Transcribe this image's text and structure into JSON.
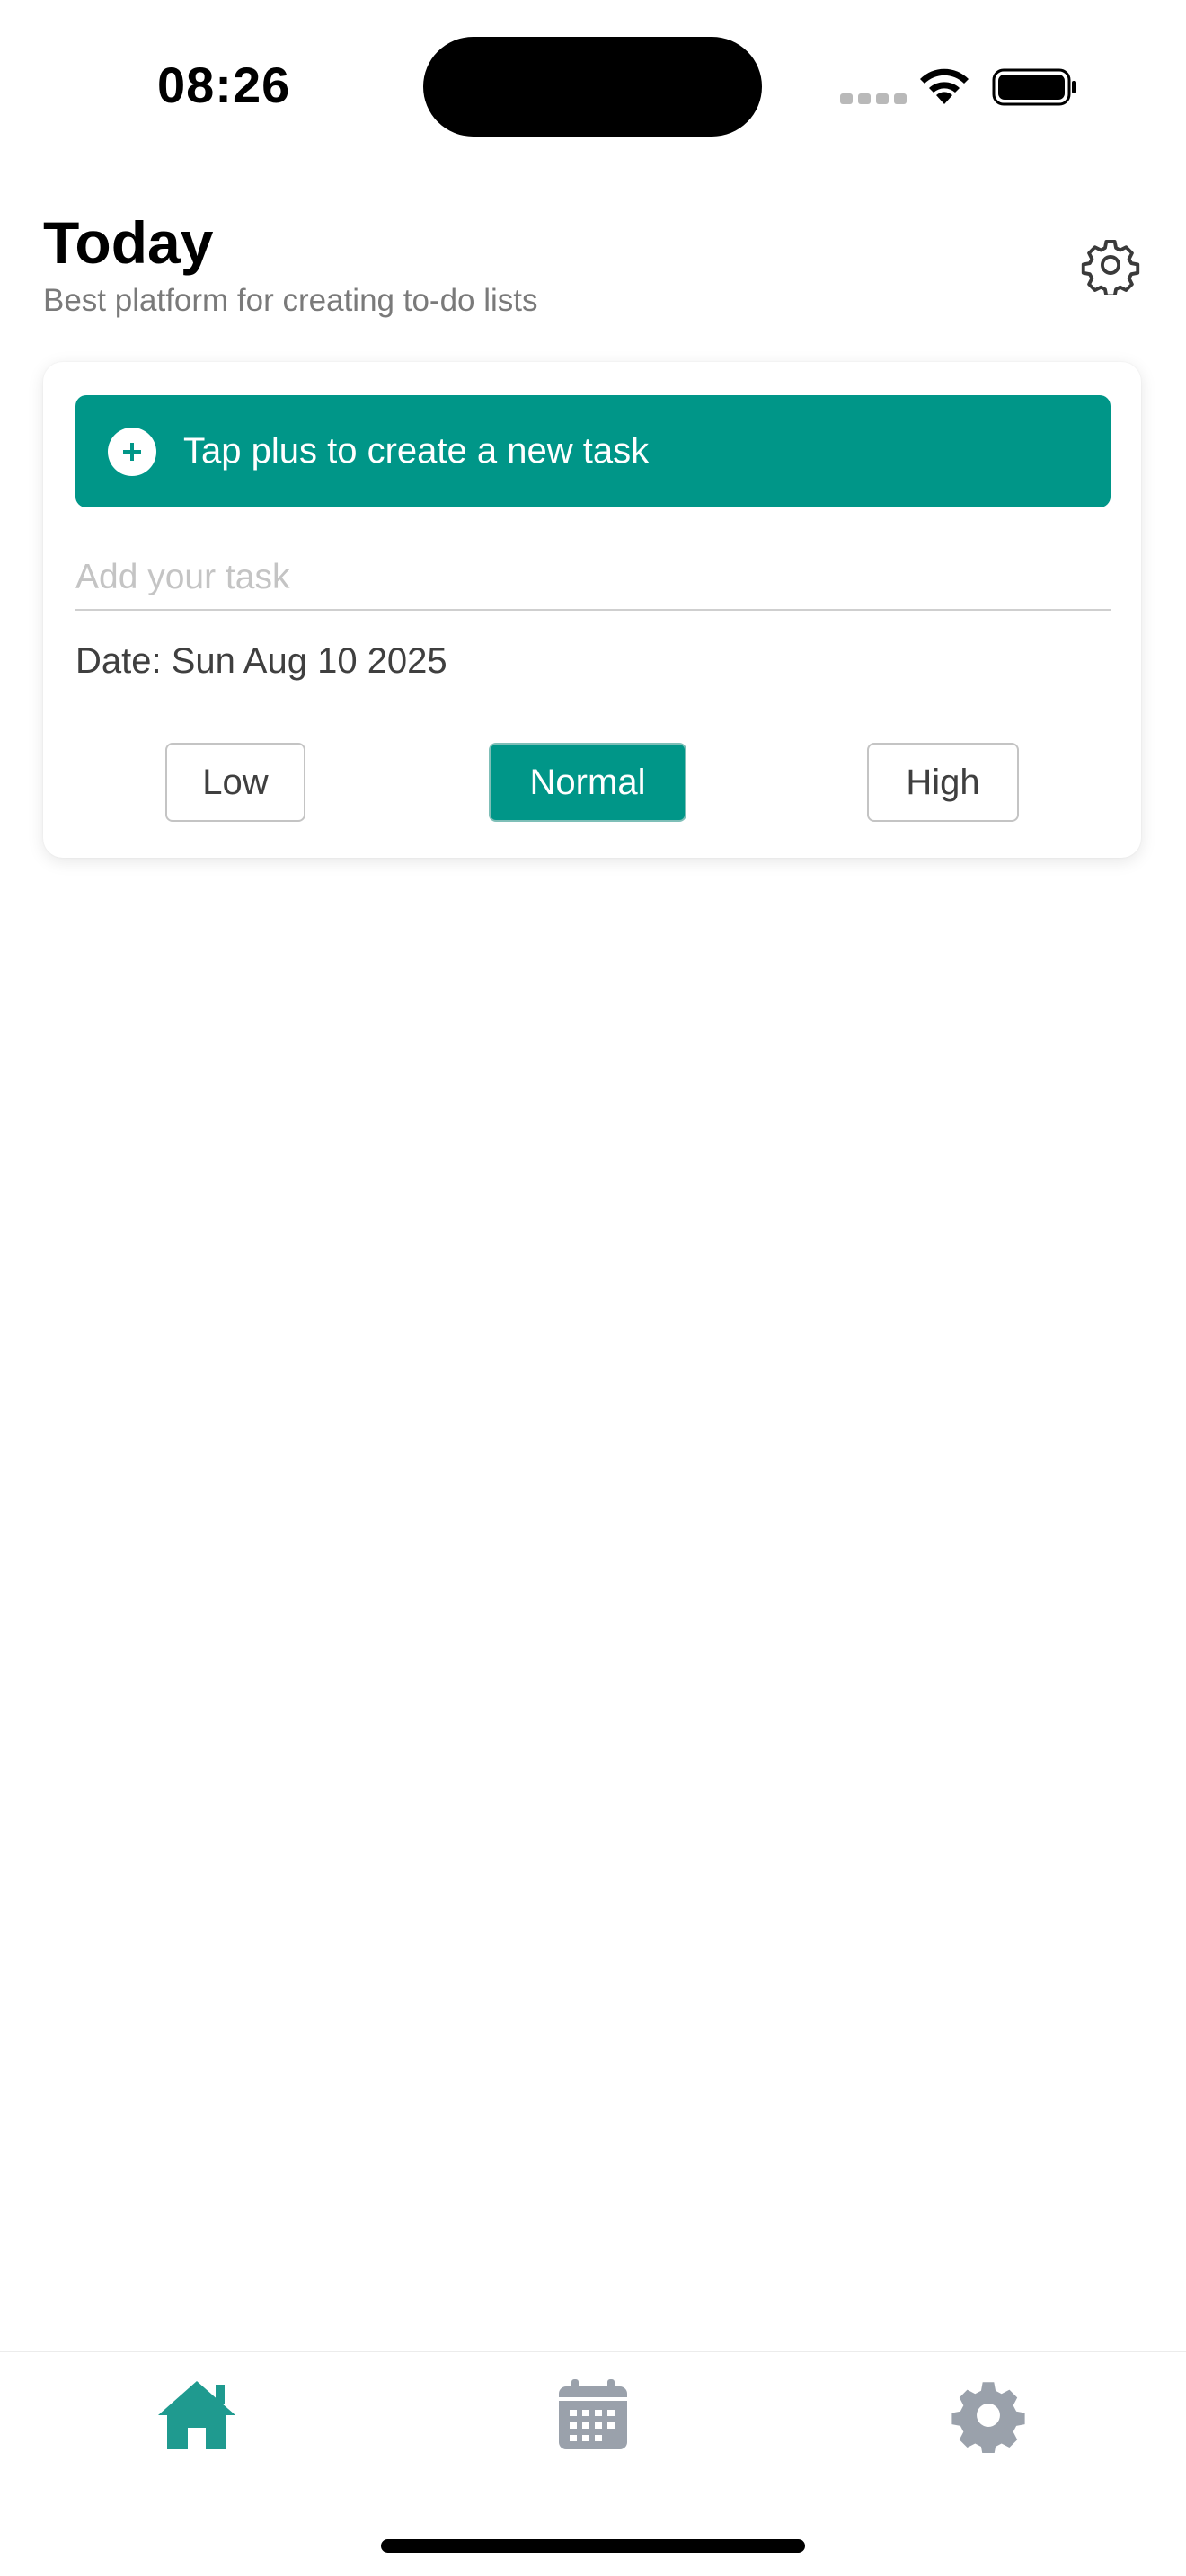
{
  "status_bar": {
    "time": "08:26"
  },
  "header": {
    "title": "Today",
    "subtitle": "Best platform for creating to-do lists",
    "settings_icon": "gear-icon"
  },
  "create_card": {
    "banner_label": "Tap plus to create a new task",
    "input_placeholder": "Add your task",
    "input_value": "",
    "date_label": "Date: Sun Aug 10 2025",
    "priority": {
      "options": [
        "Low",
        "Normal",
        "High"
      ],
      "selected": "Normal"
    }
  },
  "tab_bar": {
    "tabs": [
      {
        "icon": "home-icon",
        "active": true
      },
      {
        "icon": "calendar-icon",
        "active": false
      },
      {
        "icon": "settings-icon",
        "active": false
      }
    ]
  },
  "colors": {
    "accent": "#009688",
    "tab_active": "#1f9a8f",
    "tab_inactive": "#9aa1ab",
    "subtitle": "#7a7a7a"
  }
}
